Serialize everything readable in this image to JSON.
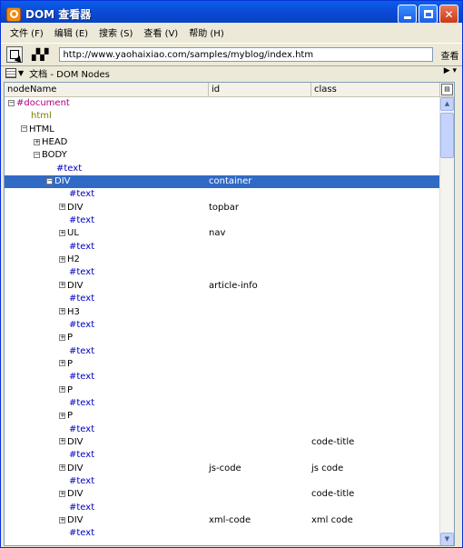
{
  "window": {
    "title": "DOM 查看器"
  },
  "menu": [
    "文件 (F)",
    "编辑 (E)",
    "搜索 (S)",
    "查看 (V)",
    "帮助 (H)"
  ],
  "toolbar": {
    "url_value": "http://www.yaohaixiao.com/samples/myblog/index.htm",
    "inspect_label": "查看"
  },
  "panel": {
    "title": "文档 - DOM Nodes"
  },
  "tree": {
    "columns": [
      "nodeName",
      "id",
      "class"
    ],
    "rows": [
      {
        "depth": 0,
        "twisty": "-",
        "name": "#document",
        "id": "",
        "class": "",
        "kind": "doc"
      },
      {
        "depth": 1,
        "twisty": "",
        "name": "html",
        "id": "",
        "class": "",
        "kind": "doctype"
      },
      {
        "depth": 1,
        "twisty": "-",
        "name": "HTML",
        "id": "",
        "class": "",
        "kind": "el"
      },
      {
        "depth": 2,
        "twisty": "+",
        "name": "HEAD",
        "id": "",
        "class": "",
        "kind": "el"
      },
      {
        "depth": 2,
        "twisty": "-",
        "name": "BODY",
        "id": "",
        "class": "",
        "kind": "el"
      },
      {
        "depth": 3,
        "twisty": "",
        "name": "#text",
        "id": "",
        "class": "",
        "kind": "text"
      },
      {
        "depth": 3,
        "twisty": "-",
        "name": "DIV",
        "id": "container",
        "class": "",
        "kind": "el",
        "selected": true
      },
      {
        "depth": 4,
        "twisty": "",
        "name": "#text",
        "id": "",
        "class": "",
        "kind": "text"
      },
      {
        "depth": 4,
        "twisty": "+",
        "name": "DIV",
        "id": "topbar",
        "class": "",
        "kind": "el"
      },
      {
        "depth": 4,
        "twisty": "",
        "name": "#text",
        "id": "",
        "class": "",
        "kind": "text"
      },
      {
        "depth": 4,
        "twisty": "+",
        "name": "UL",
        "id": "nav",
        "class": "",
        "kind": "el"
      },
      {
        "depth": 4,
        "twisty": "",
        "name": "#text",
        "id": "",
        "class": "",
        "kind": "text"
      },
      {
        "depth": 4,
        "twisty": "+",
        "name": "H2",
        "id": "",
        "class": "",
        "kind": "el"
      },
      {
        "depth": 4,
        "twisty": "",
        "name": "#text",
        "id": "",
        "class": "",
        "kind": "text"
      },
      {
        "depth": 4,
        "twisty": "+",
        "name": "DIV",
        "id": "article-info",
        "class": "",
        "kind": "el"
      },
      {
        "depth": 4,
        "twisty": "",
        "name": "#text",
        "id": "",
        "class": "",
        "kind": "text"
      },
      {
        "depth": 4,
        "twisty": "+",
        "name": "H3",
        "id": "",
        "class": "",
        "kind": "el"
      },
      {
        "depth": 4,
        "twisty": "",
        "name": "#text",
        "id": "",
        "class": "",
        "kind": "text"
      },
      {
        "depth": 4,
        "twisty": "+",
        "name": "P",
        "id": "",
        "class": "",
        "kind": "el"
      },
      {
        "depth": 4,
        "twisty": "",
        "name": "#text",
        "id": "",
        "class": "",
        "kind": "text"
      },
      {
        "depth": 4,
        "twisty": "+",
        "name": "P",
        "id": "",
        "class": "",
        "kind": "el"
      },
      {
        "depth": 4,
        "twisty": "",
        "name": "#text",
        "id": "",
        "class": "",
        "kind": "text"
      },
      {
        "depth": 4,
        "twisty": "+",
        "name": "P",
        "id": "",
        "class": "",
        "kind": "el"
      },
      {
        "depth": 4,
        "twisty": "",
        "name": "#text",
        "id": "",
        "class": "",
        "kind": "text"
      },
      {
        "depth": 4,
        "twisty": "+",
        "name": "P",
        "id": "",
        "class": "",
        "kind": "el"
      },
      {
        "depth": 4,
        "twisty": "",
        "name": "#text",
        "id": "",
        "class": "",
        "kind": "text"
      },
      {
        "depth": 4,
        "twisty": "+",
        "name": "DIV",
        "id": "",
        "class": "code-title",
        "kind": "el"
      },
      {
        "depth": 4,
        "twisty": "",
        "name": "#text",
        "id": "",
        "class": "",
        "kind": "text"
      },
      {
        "depth": 4,
        "twisty": "+",
        "name": "DIV",
        "id": "js-code",
        "class": "js code",
        "kind": "el"
      },
      {
        "depth": 4,
        "twisty": "",
        "name": "#text",
        "id": "",
        "class": "",
        "kind": "text"
      },
      {
        "depth": 4,
        "twisty": "+",
        "name": "DIV",
        "id": "",
        "class": "code-title",
        "kind": "el"
      },
      {
        "depth": 4,
        "twisty": "",
        "name": "#text",
        "id": "",
        "class": "",
        "kind": "text"
      },
      {
        "depth": 4,
        "twisty": "+",
        "name": "DIV",
        "id": "xml-code",
        "class": "xml code",
        "kind": "el"
      },
      {
        "depth": 4,
        "twisty": "",
        "name": "#text",
        "id": "",
        "class": "",
        "kind": "text"
      }
    ]
  },
  "icons": [
    "app-icon",
    "minimize-icon",
    "maximize-icon",
    "close-icon",
    "inspect-icon",
    "binoculars-icon",
    "panel-menu-icon",
    "column-picker-icon",
    "scroll-up-icon",
    "scroll-down-icon"
  ],
  "colors": {
    "selection": "#316ac5",
    "text_node": "#0000c0",
    "document_node": "#b00080",
    "titlebar": "#0a4bd6"
  }
}
